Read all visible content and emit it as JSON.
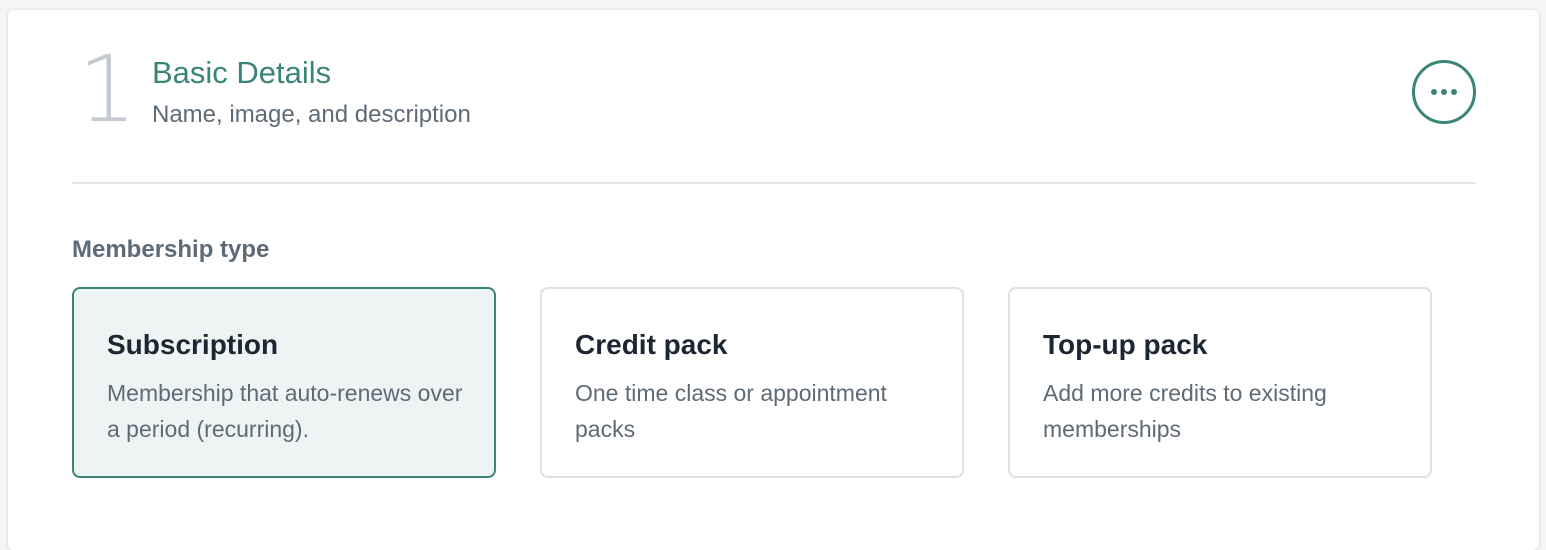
{
  "step": {
    "number": "1",
    "title": "Basic Details",
    "subtitle": "Name, image, and description"
  },
  "more_button": {
    "icon": "more-horizontal-icon"
  },
  "membership": {
    "label": "Membership type",
    "selected": "Subscription",
    "options": [
      {
        "title": "Subscription",
        "description": "Membership that auto-renews over a period (recurring)."
      },
      {
        "title": "Credit pack",
        "description": "One time class or appointment packs"
      },
      {
        "title": "Top-up pack",
        "description": "Add more credits to existing memberships"
      }
    ]
  },
  "colors": {
    "accent": "#3a8478",
    "selected_background": "#eef4f3",
    "text_primary": "#1d2733",
    "text_secondary": "#5e6b77",
    "step_number": "#c3cad1",
    "border": "#dde1e5"
  }
}
